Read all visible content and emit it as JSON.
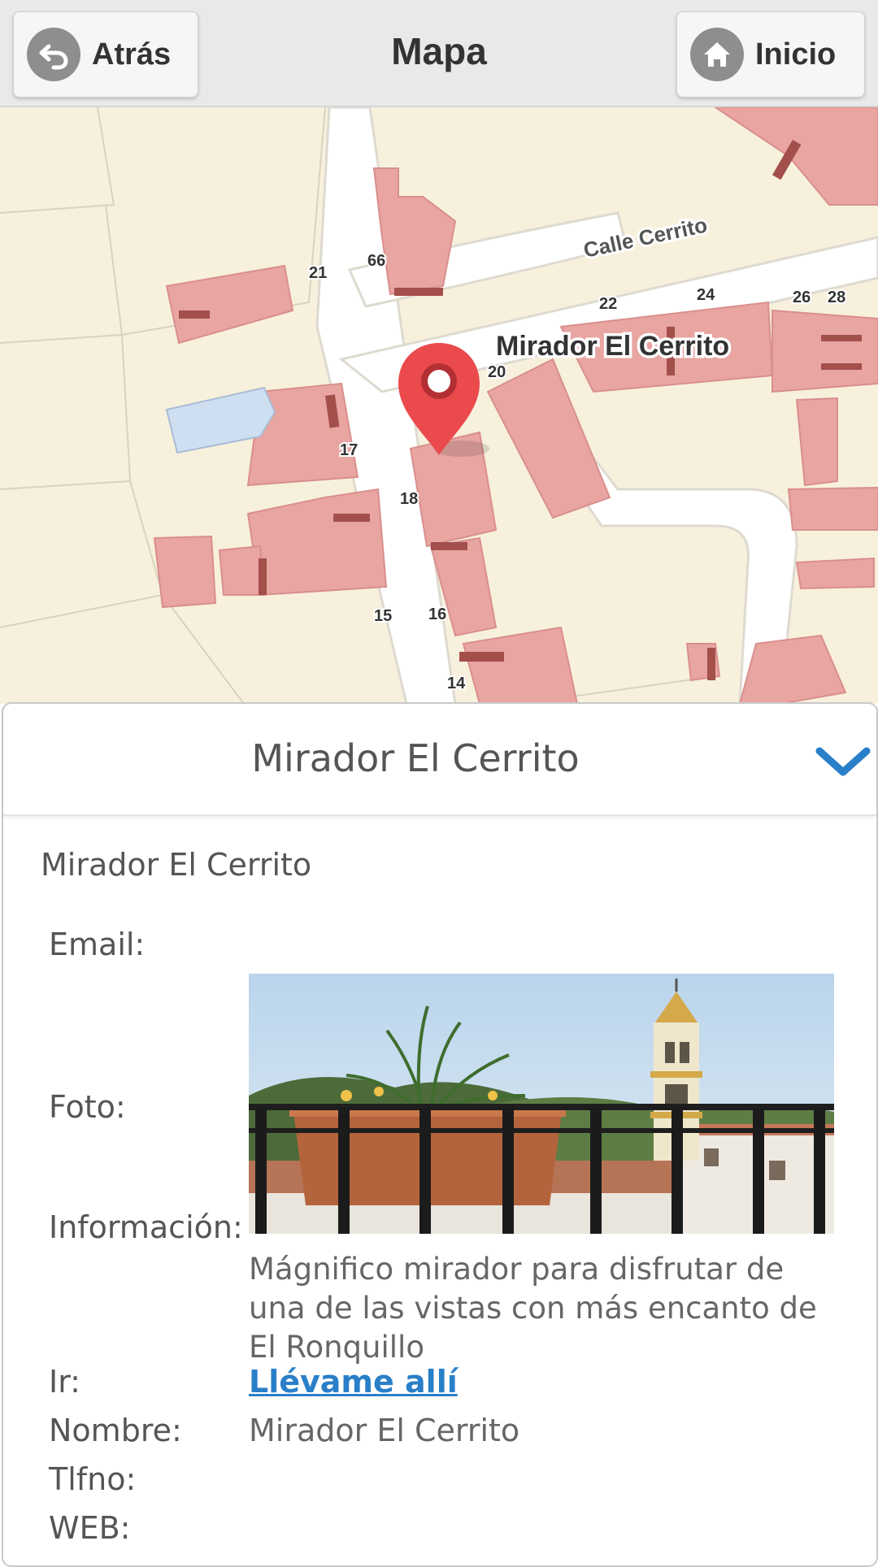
{
  "header": {
    "title": "Mapa",
    "back_label": "Atrás",
    "home_label": "Inicio"
  },
  "map": {
    "street_label": "Calle Cerrito",
    "marker_label": "Mirador El Cerrito",
    "house_numbers": [
      "21",
      "66",
      "22",
      "24",
      "26",
      "28",
      "20",
      "17",
      "18",
      "15",
      "16",
      "14"
    ]
  },
  "panel": {
    "title": "Mirador El Cerrito",
    "subtitle": "Mirador El Cerrito",
    "fields": {
      "email_label": "Email:",
      "foto_label": "Foto:",
      "info_label": "Información:",
      "info_value": "Mágnifico mirador para disfrutar de una de las vistas con más encanto de El Ronquillo",
      "ir_label": "Ir:",
      "ir_link": "Llévame allí",
      "nombre_label": "Nombre:",
      "nombre_value": "Mirador El Cerrito",
      "tlfno_label": "Tlfno:",
      "web_label": "WEB:"
    }
  },
  "colors": {
    "header_bg": "#e9e9e9",
    "marker": "#e8474a",
    "link": "#2a7fc9",
    "chevron": "#2a7fc9",
    "building": "#e8a5a2",
    "land": "#f7f0dd"
  }
}
